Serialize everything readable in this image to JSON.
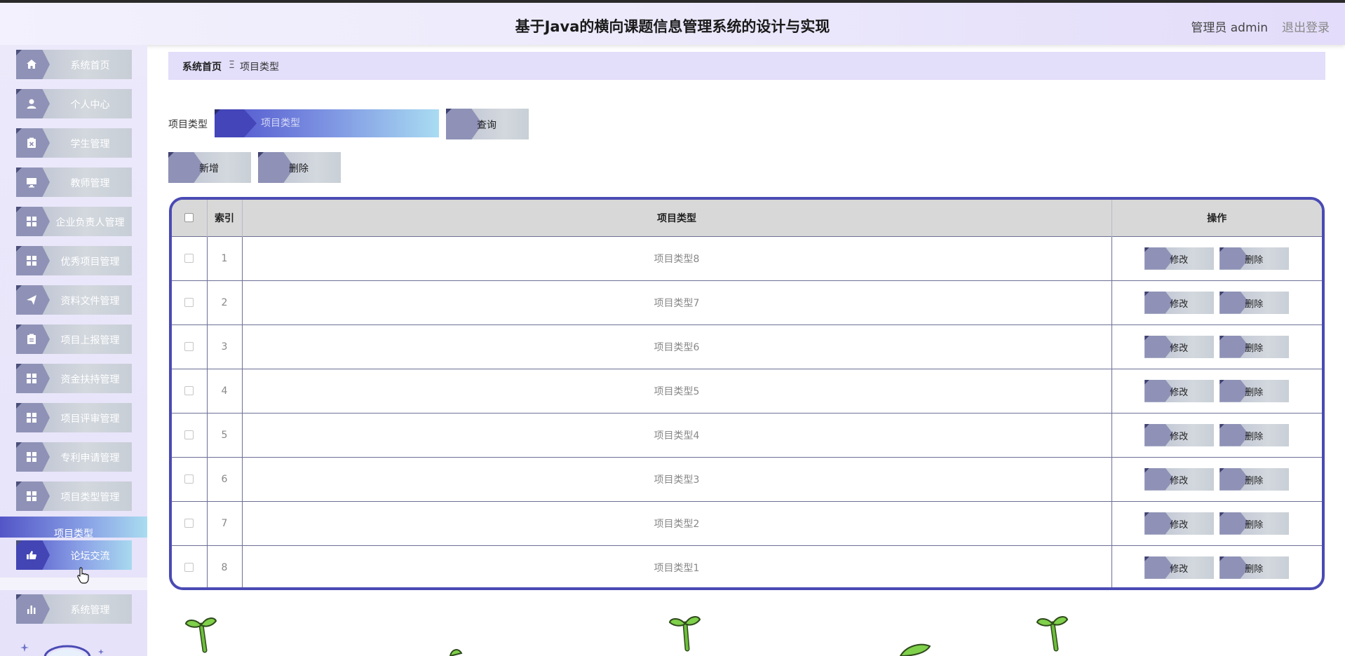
{
  "header": {
    "title": "基于Java的横向课题信息管理系统的设计与实现",
    "user": "管理员 admin",
    "logout": "退出登录"
  },
  "sidebar": {
    "items": [
      {
        "label": "系统首页",
        "icon": "home-icon"
      },
      {
        "label": "个人中心",
        "icon": "user-icon"
      },
      {
        "label": "学生管理",
        "icon": "clipboard-x-icon"
      },
      {
        "label": "教师管理",
        "icon": "monitor-icon"
      },
      {
        "label": "企业负责人管理",
        "icon": "grid-icon"
      },
      {
        "label": "优秀项目管理",
        "icon": "grid-icon"
      },
      {
        "label": "资料文件管理",
        "icon": "send-icon"
      },
      {
        "label": "项目上报管理",
        "icon": "clipboard-icon"
      },
      {
        "label": "资金扶持管理",
        "icon": "grid-icon"
      },
      {
        "label": "项目评审管理",
        "icon": "grid-icon"
      },
      {
        "label": "专利申请管理",
        "icon": "grid-icon"
      },
      {
        "label": "项目类型管理",
        "icon": "grid-icon"
      }
    ],
    "submenu_label": "项目类型",
    "forum": {
      "label": "论坛交流",
      "icon": "thumb-icon"
    },
    "system": {
      "label": "系统管理",
      "icon": "bar-chart-icon"
    }
  },
  "breadcrumb": {
    "home": "系统首页",
    "separator": "Ξ",
    "current": "项目类型"
  },
  "search": {
    "label": "项目类型",
    "placeholder": "项目类型",
    "query_button": "查询"
  },
  "actions": {
    "add": "新增",
    "delete": "删除"
  },
  "table": {
    "headers": {
      "index": "索引",
      "type": "项目类型",
      "ops": "操作"
    },
    "rows": [
      {
        "index": "1",
        "type": "项目类型8"
      },
      {
        "index": "2",
        "type": "项目类型7"
      },
      {
        "index": "3",
        "type": "项目类型6"
      },
      {
        "index": "4",
        "type": "项目类型5"
      },
      {
        "index": "5",
        "type": "项目类型4"
      },
      {
        "index": "6",
        "type": "项目类型3"
      },
      {
        "index": "7",
        "type": "项目类型2"
      },
      {
        "index": "8",
        "type": "项目类型1"
      }
    ],
    "row_buttons": {
      "edit": "修改",
      "delete": "删除"
    }
  },
  "colors": {
    "accent": "#4a4ab4",
    "header_bg": "#ece9fb",
    "breadcrumb_bg": "#e3defa",
    "sidebar_tab": "#8f92b6"
  }
}
